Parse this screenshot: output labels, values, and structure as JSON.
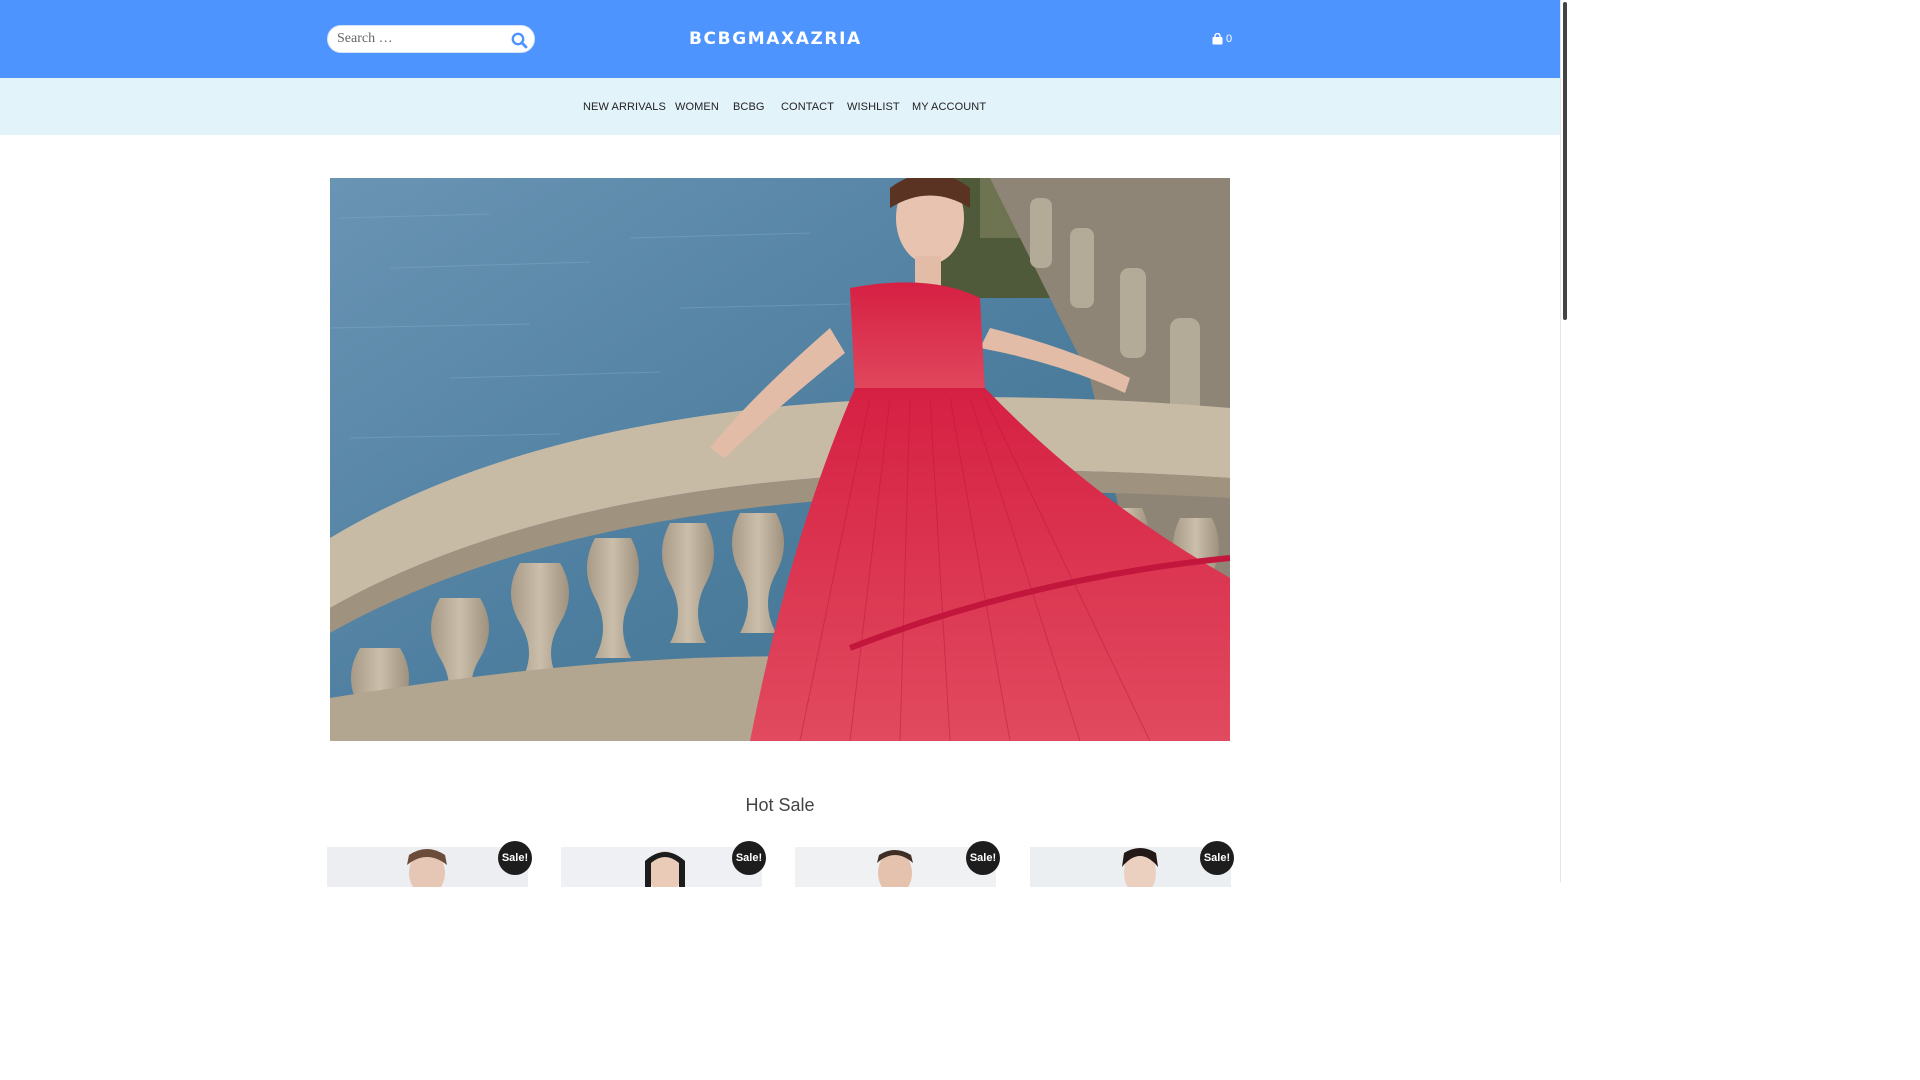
{
  "header": {
    "search_placeholder": "Search …",
    "brand": "BCBGMAXAZRIA",
    "cart_count": "0",
    "background": "#4d94ff"
  },
  "nav": {
    "items": [
      {
        "label": "NEW ARRIVALS"
      },
      {
        "label": "WOMEN"
      },
      {
        "label": "BCBG"
      },
      {
        "label": "CONTACT"
      },
      {
        "label": "WISHLIST"
      },
      {
        "label": "MY ACCOUNT"
      }
    ],
    "background": "#e3f3fa"
  },
  "hero": {
    "dress_color": "#d62043",
    "water_color": "#4f7fa0",
    "stone_color": "#cbbfac"
  },
  "hot_sale": {
    "title": "Hot Sale",
    "products": [
      {
        "badge": "Sale!"
      },
      {
        "badge": "Sale!"
      },
      {
        "badge": "Sale!"
      },
      {
        "badge": "Sale!"
      }
    ]
  }
}
